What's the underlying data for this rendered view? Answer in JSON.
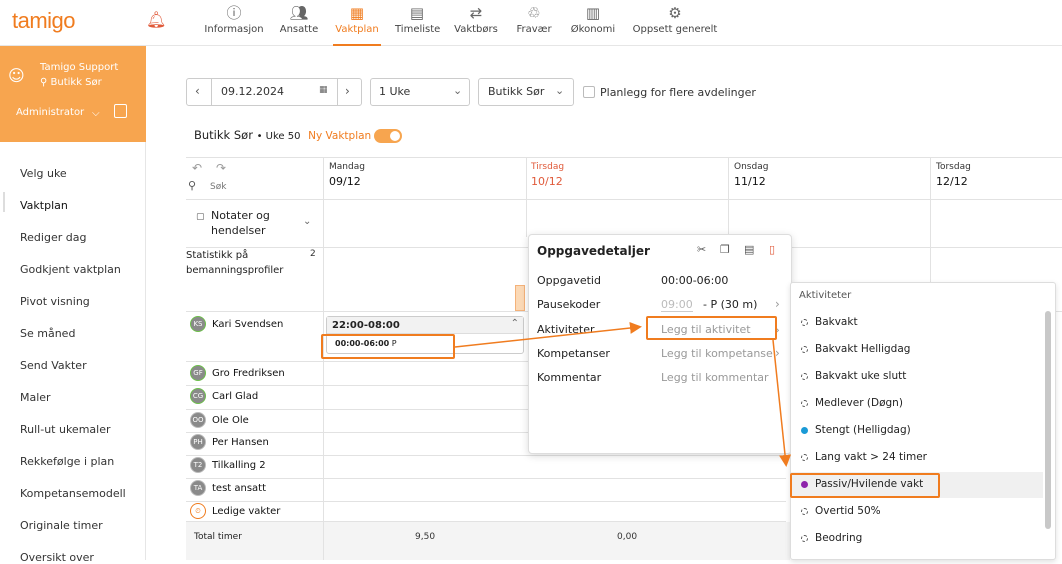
{
  "app": {
    "logo": "tamigo"
  },
  "nav": [
    {
      "label": "Informasjon",
      "icon": "info-icon"
    },
    {
      "label": "Ansatte",
      "icon": "people-icon"
    },
    {
      "label": "Vaktplan",
      "icon": "calendar-icon"
    },
    {
      "label": "Timeliste",
      "icon": "timesheet-icon"
    },
    {
      "label": "Vaktbørs",
      "icon": "swap-icon"
    },
    {
      "label": "Fravær",
      "icon": "absence-icon"
    },
    {
      "label": "Økonomi",
      "icon": "chart-icon"
    },
    {
      "label": "Oppsett generelt",
      "icon": "gear-icon"
    }
  ],
  "user": {
    "name": "Tamigo Support",
    "location": "Butikk Sør",
    "role": "Administrator"
  },
  "sidebar": [
    "Velg uke",
    "Vaktplan",
    "Rediger dag",
    "Godkjent vaktplan",
    "Pivot visning",
    "Se måned",
    "Send Vakter",
    "Maler",
    "Rull-ut ukemaler",
    "Rekkefølge i plan",
    "Kompetansemodell",
    "Originale timer",
    "Oversikt over"
  ],
  "toolbar": {
    "date": "09.12.2024",
    "period": "1 Uke",
    "department": "Butikk Sør",
    "multi_label": "Planlegg for flere avdelinger"
  },
  "subheader": {
    "title": "Butikk Sør",
    "week": "• Uke 50",
    "new_plan": "Ny Vaktplan"
  },
  "grid": {
    "search_placeholder": "Søk",
    "notes": "Notater og hendelser",
    "stats": "Statistikk på bemanningsprofiler",
    "stats_count": "2",
    "days": [
      {
        "day": "Mandag",
        "date": "09/12"
      },
      {
        "day": "Tirsdag",
        "date": "10/12"
      },
      {
        "day": "Onsdag",
        "date": "11/12"
      },
      {
        "day": "Torsdag",
        "date": "12/12"
      }
    ],
    "employees": [
      {
        "initials": "KS",
        "name": "Kari Svendsen"
      },
      {
        "initials": "GF",
        "name": "Gro Fredriksen"
      },
      {
        "initials": "CG",
        "name": "Carl Glad"
      },
      {
        "initials": "OO",
        "name": "Ole Ole"
      },
      {
        "initials": "PH",
        "name": "Per Hansen"
      },
      {
        "initials": "T2",
        "name": "Tilkalling 2"
      },
      {
        "initials": "TA",
        "name": "test ansatt"
      },
      {
        "initials": "⏲",
        "name": "Ledige vakter"
      }
    ],
    "total_label": "Total timer",
    "totals": [
      "9,50",
      "0,00"
    ],
    "shift": {
      "time": "22:00-08:00",
      "task": "00:00-06:00",
      "code": "P"
    }
  },
  "popup": {
    "title": "Oppgavedetaljer",
    "rows": [
      {
        "label": "Oppgavetid",
        "value": "00:00-06:00"
      },
      {
        "label": "Pausekoder",
        "value": "09:00",
        "extra": "- P (30 m)"
      },
      {
        "label": "Aktiviteter",
        "value": "Legg til aktivitet"
      },
      {
        "label": "Kompetanser",
        "value": "Legg til kompetanse"
      },
      {
        "label": "Kommentar",
        "value": "Legg til kommentar"
      }
    ]
  },
  "dropdown": {
    "header": "Aktiviteter",
    "options": [
      {
        "label": "Bakvakt",
        "color": ""
      },
      {
        "label": "Bakvakt Helligdag",
        "color": ""
      },
      {
        "label": "Bakvakt uke slutt",
        "color": ""
      },
      {
        "label": "Medlever (Døgn)",
        "color": ""
      },
      {
        "label": "Stengt (Helligdag)",
        "color": "#1a9ad6"
      },
      {
        "label": "Lang vakt > 24 timer",
        "color": ""
      },
      {
        "label": "Passiv/Hvilende vakt",
        "color": "#8e24aa"
      },
      {
        "label": "Overtid 50%",
        "color": ""
      },
      {
        "label": "Beodring",
        "color": ""
      }
    ]
  }
}
